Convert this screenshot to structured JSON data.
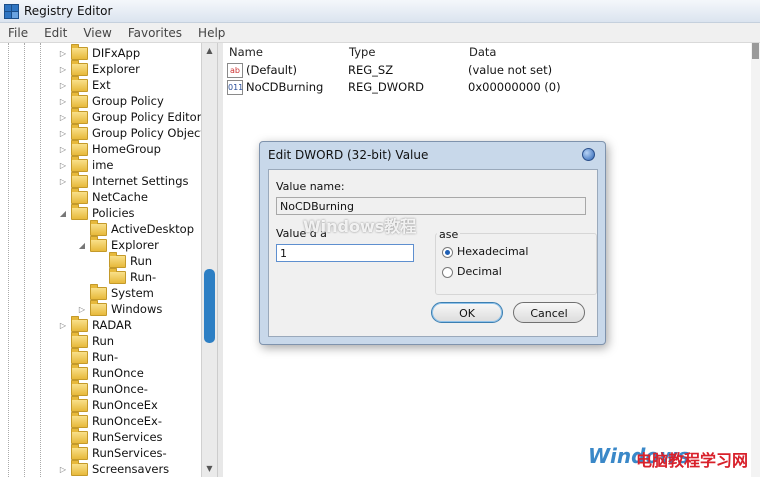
{
  "window": {
    "title": "Registry Editor"
  },
  "menu": [
    "File",
    "Edit",
    "View",
    "Favorites",
    "Help"
  ],
  "tree": {
    "items": [
      {
        "label": "DIFxApp",
        "depth": 0,
        "expander": "▷"
      },
      {
        "label": "Explorer",
        "depth": 0,
        "expander": "▷"
      },
      {
        "label": "Ext",
        "depth": 0,
        "expander": "▷"
      },
      {
        "label": "Group Policy",
        "depth": 0,
        "expander": "▷"
      },
      {
        "label": "Group Policy Editor",
        "depth": 0,
        "expander": "▷"
      },
      {
        "label": "Group Policy Objects",
        "depth": 0,
        "expander": "▷"
      },
      {
        "label": "HomeGroup",
        "depth": 0,
        "expander": "▷"
      },
      {
        "label": "ime",
        "depth": 0,
        "expander": "▷"
      },
      {
        "label": "Internet Settings",
        "depth": 0,
        "expander": "▷"
      },
      {
        "label": "NetCache",
        "depth": 0,
        "expander": ""
      },
      {
        "label": "Policies",
        "depth": 0,
        "expander": "◢"
      },
      {
        "label": "ActiveDesktop",
        "depth": 1,
        "expander": ""
      },
      {
        "label": "Explorer",
        "depth": 1,
        "expander": "◢"
      },
      {
        "label": "Run",
        "depth": 2,
        "expander": ""
      },
      {
        "label": "Run-",
        "depth": 2,
        "expander": ""
      },
      {
        "label": "System",
        "depth": 1,
        "expander": ""
      },
      {
        "label": "Windows",
        "depth": 1,
        "expander": "▷"
      },
      {
        "label": "RADAR",
        "depth": 0,
        "expander": "▷"
      },
      {
        "label": "Run",
        "depth": 0,
        "expander": ""
      },
      {
        "label": "Run-",
        "depth": 0,
        "expander": ""
      },
      {
        "label": "RunOnce",
        "depth": 0,
        "expander": ""
      },
      {
        "label": "RunOnce-",
        "depth": 0,
        "expander": ""
      },
      {
        "label": "RunOnceEx",
        "depth": 0,
        "expander": ""
      },
      {
        "label": "RunOnceEx-",
        "depth": 0,
        "expander": ""
      },
      {
        "label": "RunServices",
        "depth": 0,
        "expander": ""
      },
      {
        "label": "RunServices-",
        "depth": 0,
        "expander": ""
      },
      {
        "label": "Screensavers",
        "depth": 0,
        "expander": "▷"
      }
    ]
  },
  "list": {
    "columns": {
      "name": "Name",
      "type": "Type",
      "data": "Data"
    },
    "rows": [
      {
        "icon": "ab",
        "name": "(Default)",
        "type": "REG_SZ",
        "data": "(value not set)"
      },
      {
        "icon": "011",
        "name": "NoCDBurning",
        "type": "REG_DWORD",
        "data": "0x00000000 (0)"
      }
    ]
  },
  "dialog": {
    "title": "Edit DWORD (32-bit) Value",
    "value_name_label": "Value name:",
    "value_name": "NoCDBurning",
    "value_data_label": "Value d a",
    "value_data": "1",
    "base_label": "ase",
    "hex_label": "Hexadecimal",
    "dec_label": "Decimal",
    "base_selected": "Hexadecimal",
    "ok_label": "OK",
    "cancel_label": "Cancel"
  },
  "watermarks": {
    "center": "Windows教程",
    "corner_latin": "Windows",
    "corner_cn": "电脑教程学习网"
  },
  "colors": {
    "accent": "#2d7fc4",
    "folder": "#e7b93b",
    "dialog_frame": "#c8d8ea"
  }
}
